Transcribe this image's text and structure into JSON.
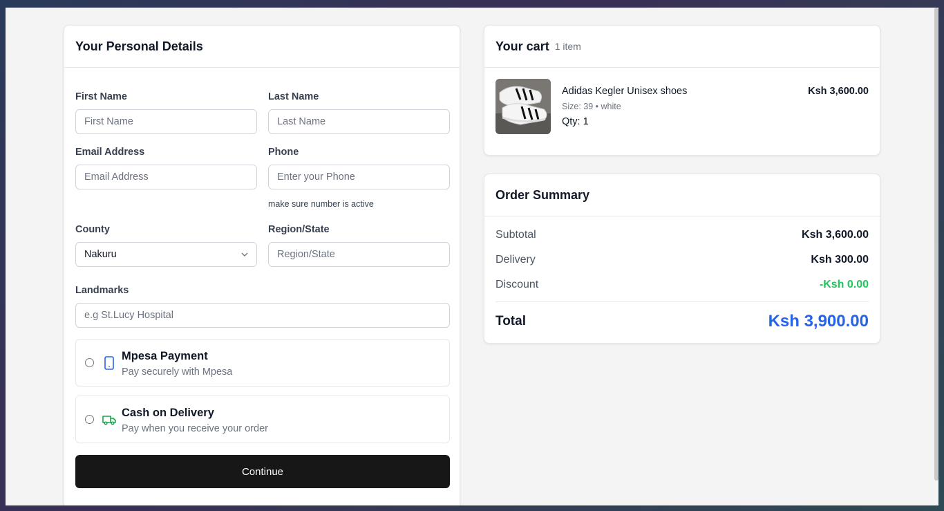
{
  "personal": {
    "title": "Your Personal Details",
    "first_name": {
      "label": "First Name",
      "placeholder": "First Name"
    },
    "last_name": {
      "label": "Last Name",
      "placeholder": "Last Name"
    },
    "email": {
      "label": "Email Address",
      "placeholder": "Email Address"
    },
    "phone": {
      "label": "Phone",
      "placeholder": "Enter your Phone",
      "hint": "make sure number is active"
    },
    "county": {
      "label": "County",
      "value": "Nakuru"
    },
    "region": {
      "label": "Region/State",
      "placeholder": "Region/State"
    },
    "landmarks": {
      "label": "Landmarks",
      "placeholder": "e.g St.Lucy Hospital"
    },
    "payment_options": [
      {
        "title": "Mpesa Payment",
        "subtitle": "Pay securely with Mpesa",
        "icon": "phone-icon",
        "icon_color": "#2563eb"
      },
      {
        "title": "Cash on Delivery",
        "subtitle": "Pay when you receive your order",
        "icon": "truck-icon",
        "icon_color": "#16a34a"
      }
    ],
    "continue_label": "Continue"
  },
  "cart": {
    "title": "Your cart",
    "count": "1 item",
    "item": {
      "name": "Adidas Kegler Unisex shoes",
      "meta": "Size: 39 • white",
      "qty": "Qty: 1",
      "price": "Ksh 3,600.00",
      "image": "sneaker-product-image"
    }
  },
  "summary": {
    "title": "Order Summary",
    "subtotal": {
      "label": "Subtotal",
      "value": "Ksh 3,600.00"
    },
    "delivery": {
      "label": "Delivery",
      "value": "Ksh 300.00"
    },
    "discount": {
      "label": "Discount",
      "value": "-Ksh 0.00",
      "color": "#22c55e"
    },
    "total": {
      "label": "Total",
      "value": "Ksh 3,900.00",
      "color": "#2563eb"
    }
  }
}
